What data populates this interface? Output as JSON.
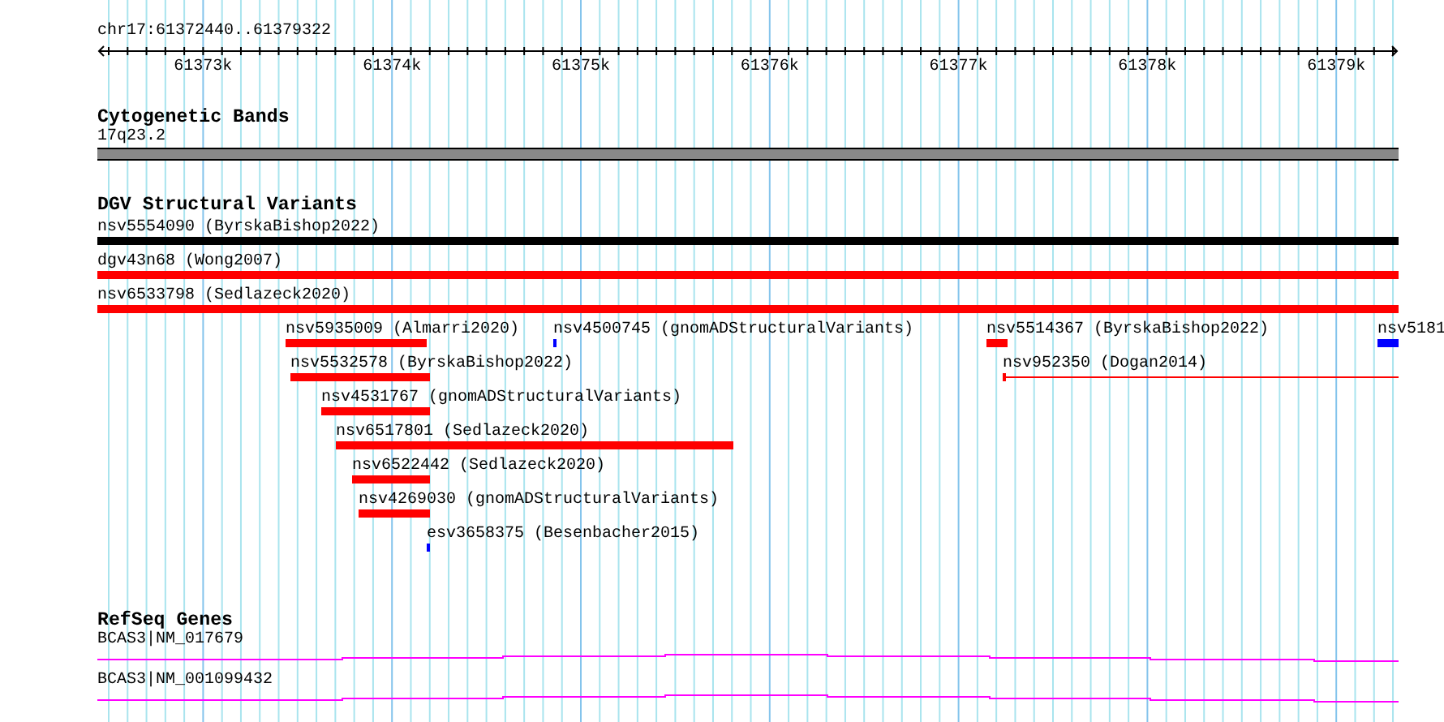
{
  "location": "chr17:61372440..61379322",
  "ruler": {
    "ticks": [
      "61373k",
      "61374k",
      "61375k",
      "61376k",
      "61377k",
      "61378k",
      "61379k"
    ]
  },
  "tracks": [
    {
      "kind": "bands",
      "title": "Cytogenetic Bands",
      "features": [
        {
          "label": "17q23.2"
        }
      ]
    },
    {
      "kind": "variants",
      "title": "DGV Structural Variants",
      "features": [
        {
          "label": "nsv5554090 (ByrskaBishop2022)",
          "kind": "bar",
          "color": "#000000"
        },
        {
          "label": "dgv43n68 (Wong2007)",
          "kind": "bar",
          "color": "#ff0000"
        },
        {
          "label": "nsv6533798 (Sedlazeck2020)",
          "kind": "bar",
          "color": "#ff0000"
        },
        {
          "label": "nsv5935009 (Almarri2020)",
          "kind": "bar",
          "color": "#ff0000"
        },
        {
          "label": "nsv4500745 (gnomADStructuralVariants)",
          "kind": "bar",
          "color": "#0000ff"
        },
        {
          "label": "nsv5514367 (ByrskaBishop2022)",
          "kind": "bar",
          "color": "#ff0000"
        },
        {
          "label": "nsv5181",
          "kind": "bar",
          "color": "#0000ff"
        },
        {
          "label": "nsv5532578 (ByrskaBishop2022)",
          "kind": "bar",
          "color": "#ff0000"
        },
        {
          "label": "nsv952350 (Dogan2014)",
          "kind": "line",
          "color": "#ff0000"
        },
        {
          "label": "nsv4531767 (gnomADStructuralVariants)",
          "kind": "bar",
          "color": "#ff0000"
        },
        {
          "label": "nsv6517801 (Sedlazeck2020)",
          "kind": "bar",
          "color": "#ff0000"
        },
        {
          "label": "nsv6522442 (Sedlazeck2020)",
          "kind": "bar",
          "color": "#ff0000"
        },
        {
          "label": "nsv4269030 (gnomADStructuralVariants)",
          "kind": "bar",
          "color": "#ff0000"
        },
        {
          "label": "esv3658375 (Besenbacher2015)",
          "kind": "bar",
          "color": "#0000ff"
        }
      ]
    },
    {
      "kind": "genes",
      "title": "RefSeq Genes",
      "features": [
        {
          "label": "BCAS3|NM_017679"
        },
        {
          "label": "BCAS3|NM_001099432"
        }
      ]
    }
  ]
}
